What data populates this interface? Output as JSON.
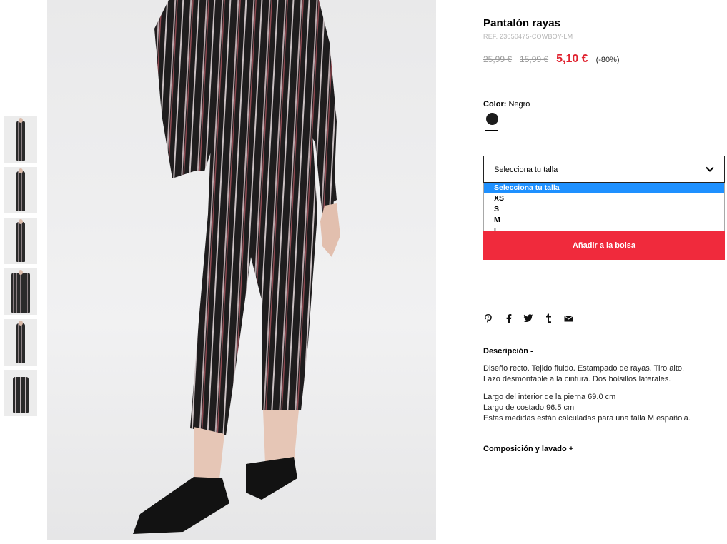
{
  "product": {
    "title": "Pantalón rayas",
    "ref": "REF. 23050475-COWBOY-LM",
    "original_price": "25,99 €",
    "previous_price": "15,99 €",
    "sale_price": "5,10 €",
    "discount": "(-80%)"
  },
  "color": {
    "label": "Color:",
    "value": "Negro",
    "swatch_color": "#1c1c1c"
  },
  "size_select": {
    "placeholder": "Selecciona tu talla",
    "options": [
      "Selecciona tu talla",
      "XS",
      "S",
      "M",
      "L"
    ],
    "selected_index": 0
  },
  "cart": {
    "button_label": "Añadir a la bolsa",
    "button_color": "#f02a3c"
  },
  "share_icons": [
    "pinterest-icon",
    "facebook-icon",
    "twitter-icon",
    "tumblr-icon",
    "email-icon"
  ],
  "description": {
    "heading": "Descripción -",
    "paragraph1_line1": "Diseño recto. Tejido fluido. Estampado de rayas. Tiro alto.",
    "paragraph1_line2": "Lazo desmontable a la cintura. Dos bolsillos laterales.",
    "paragraph2_line1": "Largo del interior de la pierna 69.0 cm",
    "paragraph2_line2": "Largo de costado 96.5 cm",
    "paragraph2_line3": "Estas medidas están calculadas para una talla M española."
  },
  "composition": {
    "heading": "Composición y lavado +"
  },
  "gallery": {
    "thumbnail_count": 6
  }
}
